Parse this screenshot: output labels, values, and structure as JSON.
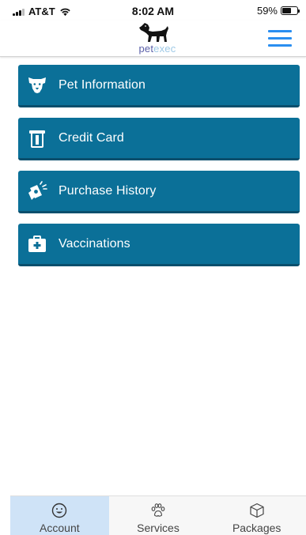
{
  "status_bar": {
    "carrier": "AT&T",
    "time": "8:02 AM",
    "battery": "59%",
    "battery_level": 0.59
  },
  "header": {
    "logo_text_pet": "pet",
    "logo_text_exec": "exec",
    "menu_icon": "hamburger-icon",
    "accent_color": "#2a8ef0"
  },
  "menu": {
    "tile_color": "#0b7098",
    "items": [
      {
        "label": "Pet Information",
        "icon": "dog-face-icon"
      },
      {
        "label": "Credit Card",
        "icon": "credit-card-icon"
      },
      {
        "label": "Purchase History",
        "icon": "money-hand-icon"
      },
      {
        "label": "Vaccinations",
        "icon": "first-aid-kit-icon"
      }
    ]
  },
  "tab_bar": {
    "active_color": "#cfe3f7",
    "tabs": [
      {
        "label": "Account",
        "icon": "smiley-icon",
        "active": true
      },
      {
        "label": "Services",
        "icon": "paw-icon",
        "active": false
      },
      {
        "label": "Packages",
        "icon": "box-icon",
        "active": false
      }
    ]
  }
}
